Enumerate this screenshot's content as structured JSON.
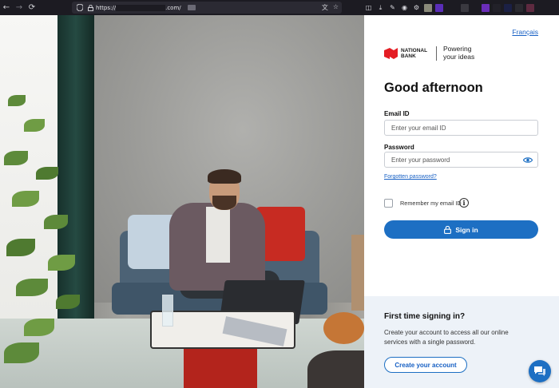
{
  "browser": {
    "url_prefix": "https://",
    "url_suffix": ".com/",
    "icons": [
      "back-icon",
      "forward-icon",
      "reload-icon",
      "shield-icon",
      "lock-icon",
      "translate-icon",
      "star-icon",
      "pocket-icon",
      "download-icon",
      "tools-icon",
      "account-icon",
      "settings-icon"
    ]
  },
  "panel": {
    "language_link": "Français",
    "logo": {
      "name": "NATIONAL BANK",
      "tagline": "Powering your ideas",
      "brand_color": "#e41c23"
    },
    "greeting": "Good afternoon",
    "email": {
      "label": "Email ID",
      "placeholder": "Enter your email ID"
    },
    "password": {
      "label": "Password",
      "placeholder": "Enter your password"
    },
    "forgot_link": "Forgotten password?",
    "remember_label": "Remember my email ID",
    "info_symbol": "i",
    "signin_label": "Sign in",
    "signup": {
      "heading": "First time signing in?",
      "description": "Create your account to access all our online services with a single password.",
      "button_label": "Create your account"
    },
    "accent_color": "#1d6fc3"
  }
}
